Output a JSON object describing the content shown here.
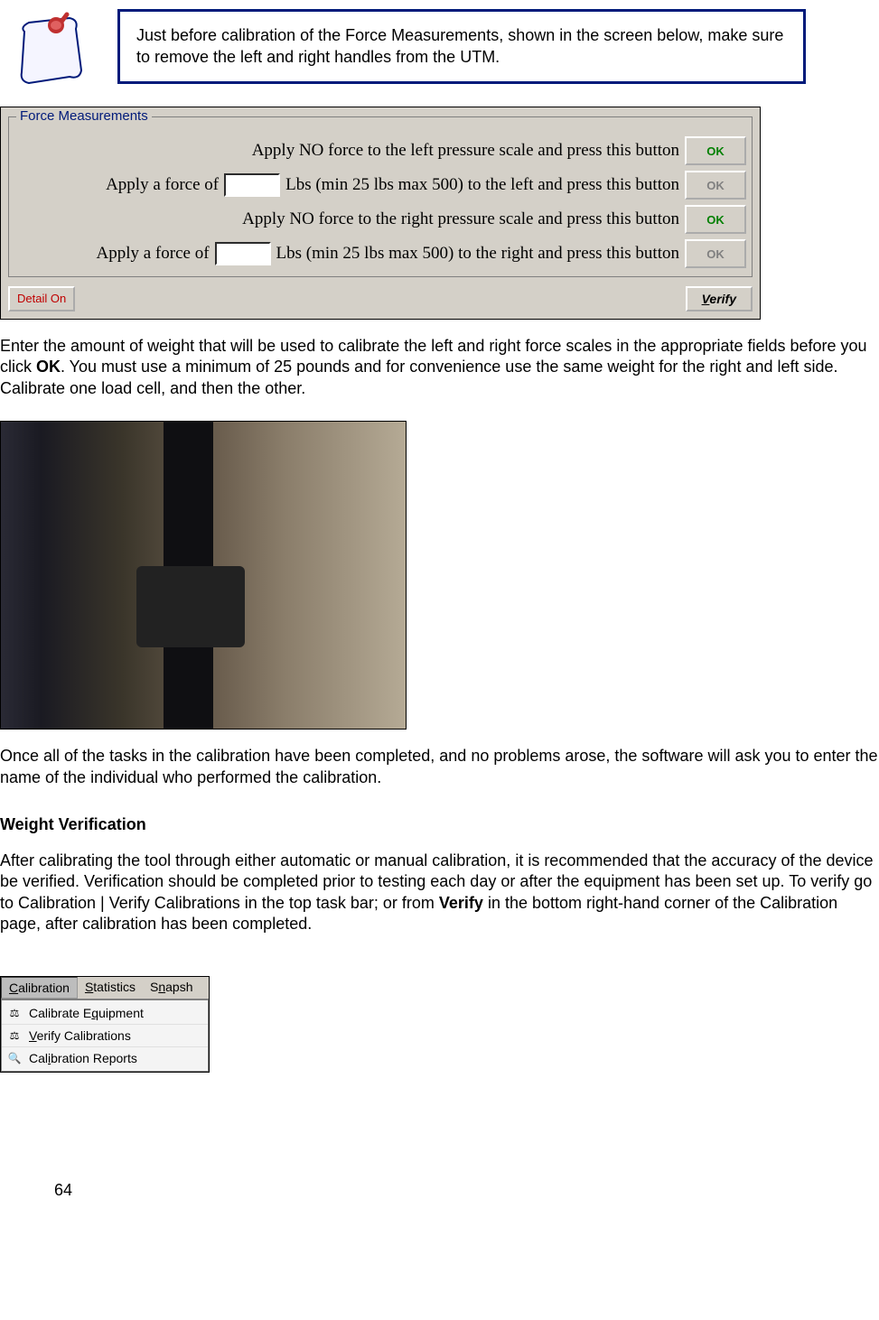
{
  "note": {
    "text": "Just before calibration of the Force Measurements, shown in the screen below, make sure to remove the left and right handles from the UTM."
  },
  "dialog": {
    "group_title": "Force Measurements",
    "rows": [
      {
        "pre": "Apply NO force to the left pressure scale and press this button",
        "btn": "OK",
        "btn_state": "green"
      },
      {
        "pre": "Apply a force of",
        "input": "",
        "post": "Lbs (min 25 lbs max 500) to the left and press this button",
        "btn": "OK",
        "btn_state": "gray"
      },
      {
        "pre": "Apply NO force to the right pressure scale and press this button",
        "btn": "OK",
        "btn_state": "green"
      },
      {
        "pre": "Apply a force of",
        "input": "",
        "post": "Lbs (min 25 lbs max 500) to the right and press this button",
        "btn": "OK",
        "btn_state": "gray"
      }
    ],
    "detail_btn": "Detail On",
    "verify_btn_prefix": "V",
    "verify_btn_rest": "erify"
  },
  "para1": {
    "seg1": "Enter the amount of weight that will be used to calibrate the left and right force scales in the appropriate fields before you click ",
    "bold1": "OK",
    "seg2": ".  You must use a minimum of 25 pounds and for convenience use the same weight for the right and left side.  Calibrate one load cell, and then the other."
  },
  "para2": "Once all of the tasks in the calibration have been completed, and no problems arose, the software will ask you to enter the name of the individual who performed the calibration.",
  "section_head": "Weight Verification",
  "para3": {
    "seg1": "After calibrating the tool through either automatic or manual calibration, it is recommended that the accuracy of the device be verified.  Verification should be completed prior to testing each day or after the equipment has been set up. To verify go to  Calibration | Verify Calibrations in the top task bar; or from ",
    "bold1": "Verify",
    "seg2": " in the bottom right-hand corner of the Calibration page, after calibration has been completed."
  },
  "menu": {
    "bar": [
      {
        "u": "C",
        "rest": "alibration"
      },
      {
        "u": "S",
        "rest": "tatistics"
      },
      {
        "pre": "S",
        "u": "n",
        "rest": "apsh"
      }
    ],
    "items": [
      {
        "icon": "scale-icon",
        "pre": "Calibrate E",
        "u": "q",
        "rest": "uipment"
      },
      {
        "icon": "scale-icon",
        "u": "V",
        "rest": "erify Calibrations"
      },
      {
        "icon": "report-icon",
        "pre": "Cal",
        "u": "i",
        "rest": "bration Reports"
      }
    ]
  },
  "page_number": "64"
}
